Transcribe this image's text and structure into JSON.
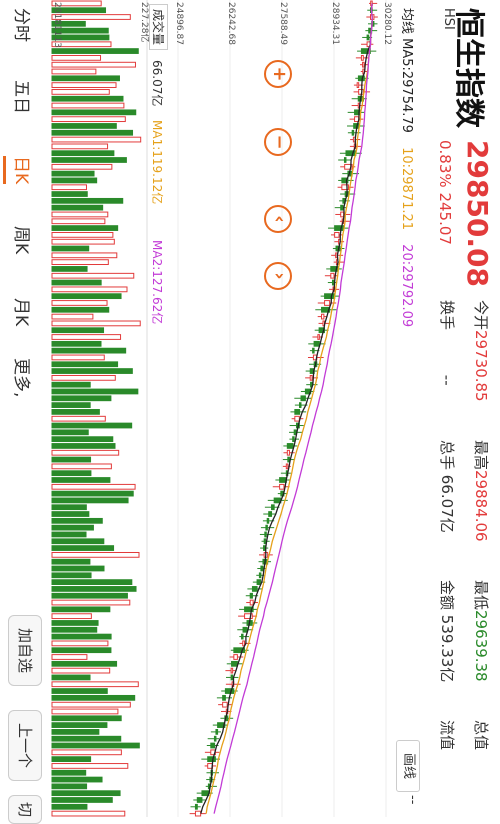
{
  "header": {
    "title": "恒生指数",
    "code": "HSI",
    "price": "29850.08",
    "change_pct": "0.83%",
    "change_abs": "245.07",
    "stats": [
      {
        "label": "今开",
        "value": "29730.85",
        "color": "red"
      },
      {
        "label": "最高",
        "value": "29884.06",
        "color": "red"
      },
      {
        "label": "最低",
        "value": "29639.38",
        "color": "green"
      },
      {
        "label": "总值",
        "value": "",
        "color": "dark"
      },
      {
        "label": "换手",
        "value": "--",
        "color": "dark"
      },
      {
        "label": "总手",
        "value": "66.07亿",
        "color": "dark"
      },
      {
        "label": "金额",
        "value": "539.33亿",
        "color": "dark"
      },
      {
        "label": "流值",
        "value": "",
        "color": "dark"
      }
    ],
    "ma": {
      "ma5": "均线 MA5:29754.79",
      "ma10": "10:29871.21",
      "ma20": "20:29792.09"
    },
    "draw_button": "画线",
    "edge_dash": "--"
  },
  "axis": {
    "price_ticks": [
      "30280.12",
      "28934.31",
      "27588.49",
      "26242.68",
      "24896.87"
    ],
    "date_label": "20181113",
    "vol_top": "227.28亿"
  },
  "volume": {
    "label": "成交量",
    "value": "66.07亿",
    "ma1": "MA1:119.12亿",
    "ma2": "MA2:127.62亿"
  },
  "tabs": [
    "分时",
    "五日",
    "日K",
    "周K",
    "月K",
    "更多,"
  ],
  "active_tab": 2,
  "actions": {
    "add": "加自选",
    "prev": "上一个",
    "switch": "切"
  },
  "colors": {
    "up": "#e23b3b",
    "down": "#2a8a2a",
    "ma5": "#222222",
    "ma10": "#e5a11a",
    "ma20": "#c23bd6",
    "accent": "#e8691f"
  }
}
